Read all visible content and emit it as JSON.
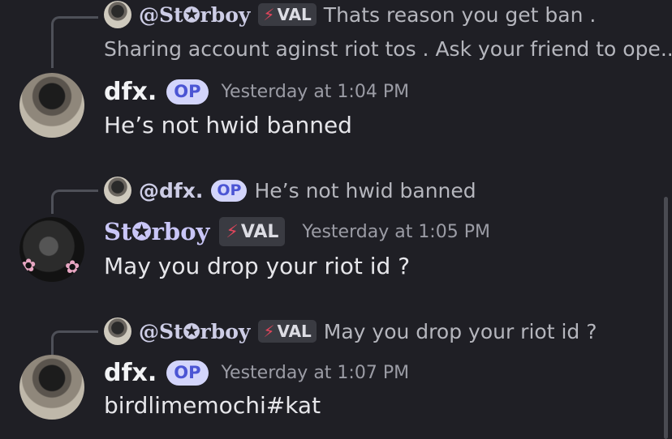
{
  "messages": [
    {
      "reply": {
        "author": "@St✪rboy",
        "tag": "VAL",
        "tag_icon": "⚡",
        "text_line1": "Thats reason you get ban .",
        "text_line2": "Sharing account aginst riot tos . Ask your friend to ope..."
      },
      "author": "dfx.",
      "badge": "OP",
      "timestamp": "Yesterday at 1:04 PM",
      "content": "He’s not hwid banned"
    },
    {
      "reply": {
        "author": "@dfx.",
        "badge": "OP",
        "text": "He’s not hwid banned"
      },
      "author": "St✪rboy",
      "tag": "VAL",
      "tag_icon": "⚡",
      "timestamp": "Yesterday at 1:05 PM",
      "content": "May you drop your riot id ?"
    },
    {
      "reply": {
        "author": "@St✪rboy",
        "tag": "VAL",
        "tag_icon": "⚡",
        "text": "May you drop your riot id ?"
      },
      "author": "dfx.",
      "badge": "OP",
      "timestamp": "Yesterday at 1:07 PM",
      "content": "birdlimemochi#kat"
    }
  ],
  "icons": {
    "flower": "✿"
  },
  "colors": {
    "background": "#1f1f25",
    "op_badge_bg": "#d3d5fb",
    "op_badge_text": "#4b55d4",
    "bolt": "#e0455b"
  }
}
